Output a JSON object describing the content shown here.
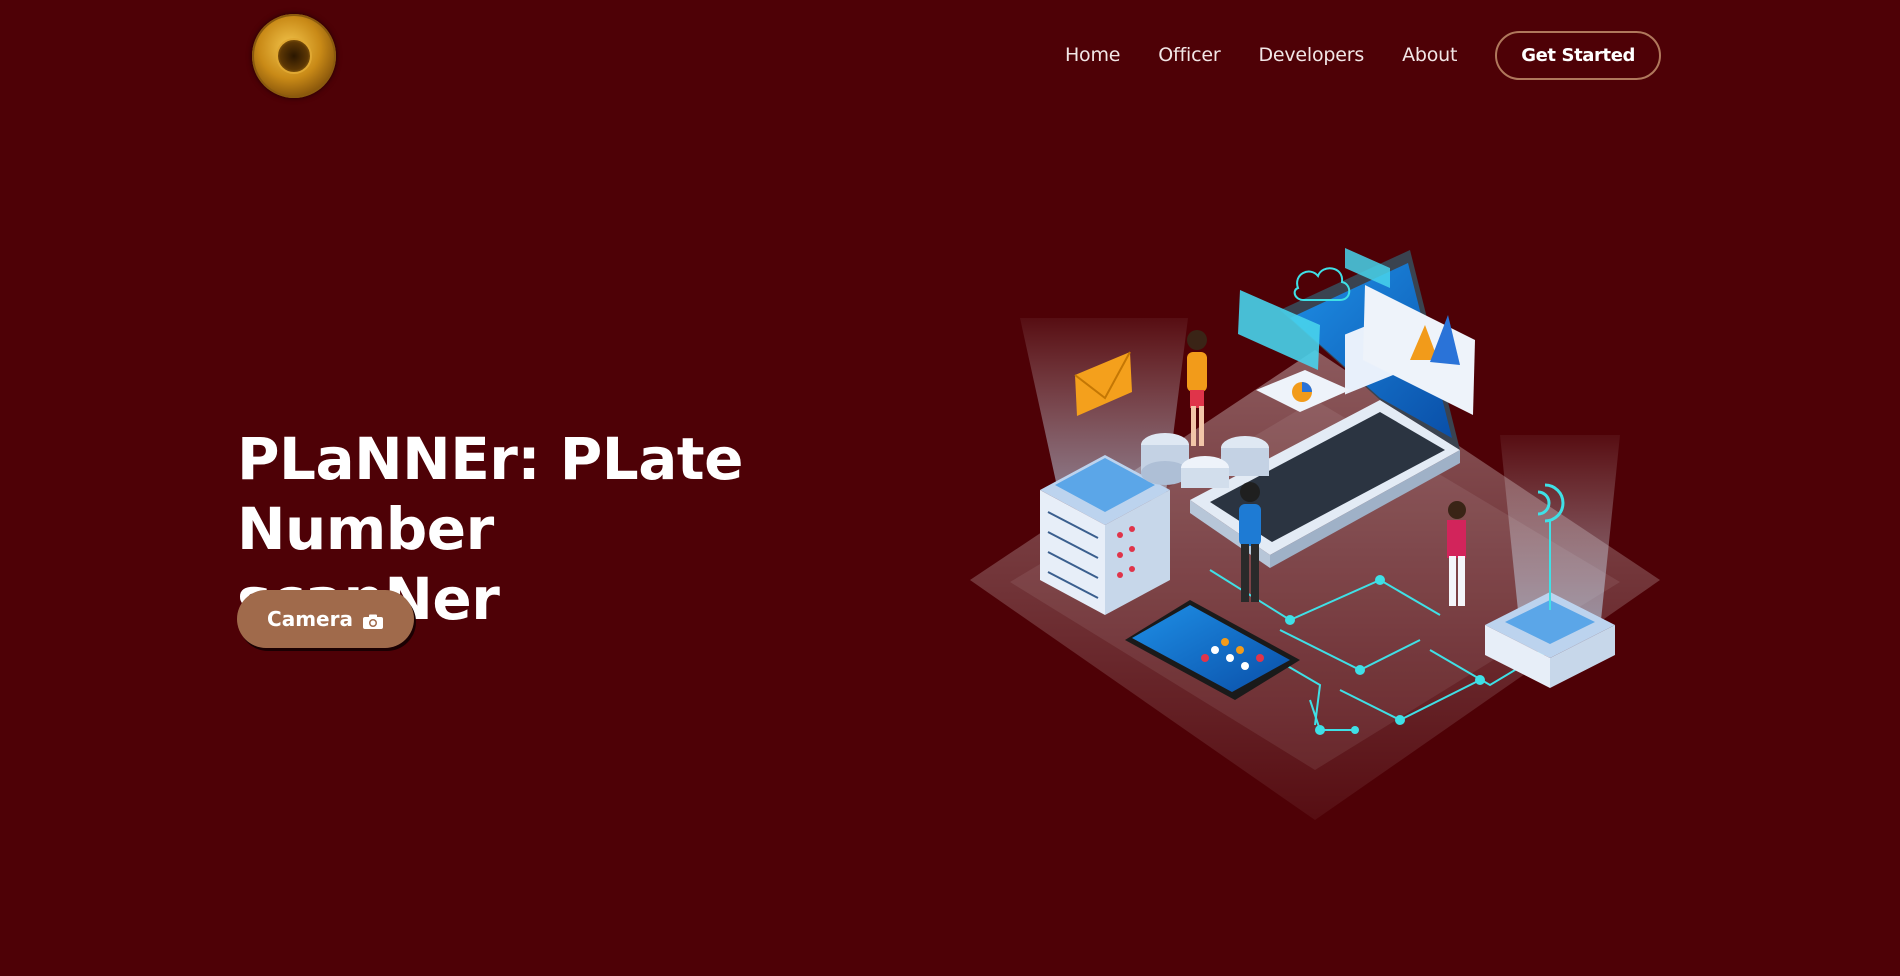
{
  "header": {
    "logo": "seal-logo",
    "nav": [
      {
        "label": "Home"
      },
      {
        "label": "Officer"
      },
      {
        "label": "Developers"
      },
      {
        "label": "About"
      }
    ],
    "cta_label": "Get Started"
  },
  "hero": {
    "title_line1": "PLaNNEr: PLate",
    "title_line2": "Number scanNer",
    "camera_label": "Camera",
    "camera_icon": "camera-icon",
    "illustration": "isometric-tech-illustration"
  },
  "colors": {
    "background": "#4e0106",
    "button": "#a06a4b",
    "cta_border": "#b0785c"
  }
}
